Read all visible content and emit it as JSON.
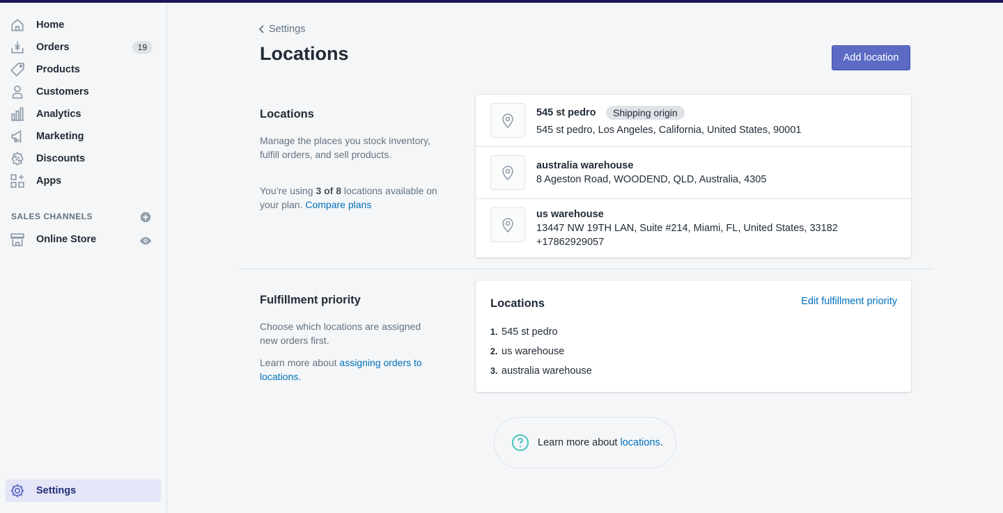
{
  "sidebar": {
    "items": [
      {
        "label": "Home",
        "icon": "home-icon"
      },
      {
        "label": "Orders",
        "icon": "orders-icon",
        "badge": "19"
      },
      {
        "label": "Products",
        "icon": "tag-icon"
      },
      {
        "label": "Customers",
        "icon": "person-icon"
      },
      {
        "label": "Analytics",
        "icon": "bar-chart-icon"
      },
      {
        "label": "Marketing",
        "icon": "megaphone-icon"
      },
      {
        "label": "Discounts",
        "icon": "discount-icon"
      },
      {
        "label": "Apps",
        "icon": "apps-icon"
      }
    ],
    "sales_channels_title": "SALES CHANNELS",
    "online_store": "Online Store",
    "settings": "Settings"
  },
  "header": {
    "breadcrumb": "Settings",
    "title": "Locations",
    "add_button": "Add location"
  },
  "locations_section": {
    "title": "Locations",
    "description": "Manage the places you stock inventory, fulfill orders, and sell products.",
    "usage_prefix": "You’re using ",
    "usage_count": "3 of 8",
    "usage_suffix": " locations available on your plan. ",
    "compare_link": "Compare plans",
    "locations": [
      {
        "name": "545 st pedro",
        "badge": "Shipping origin",
        "address": "545 st pedro, Los Angeles, California, United States, 90001"
      },
      {
        "name": "australia warehouse",
        "address": "8 Ageston Road, WOODEND, QLD, Australia, 4305"
      },
      {
        "name": "us warehouse",
        "address": "13447 NW 19TH LAN, Suite #214, Miami, FL, United States, 33182",
        "phone": "+17862929057"
      }
    ]
  },
  "fulfillment_section": {
    "title": "Fulfillment priority",
    "description": "Choose which locations are assigned new orders first.",
    "learn_prefix": "Learn more about ",
    "learn_link": "assigning orders to locations",
    "learn_suffix": ".",
    "card_title": "Locations",
    "edit_link": "Edit fulfillment priority",
    "priority": [
      {
        "num": "1.",
        "name": "545 st pedro"
      },
      {
        "num": "2.",
        "name": "us warehouse"
      },
      {
        "num": "3.",
        "name": "australia warehouse"
      }
    ]
  },
  "help": {
    "prefix": "Learn more about ",
    "link": "locations",
    "suffix": "."
  },
  "colors": {
    "primary": "#5c6ac4",
    "link": "#006fbb",
    "top_bar": "#1c1859",
    "help_icon": "#47c1bf"
  }
}
